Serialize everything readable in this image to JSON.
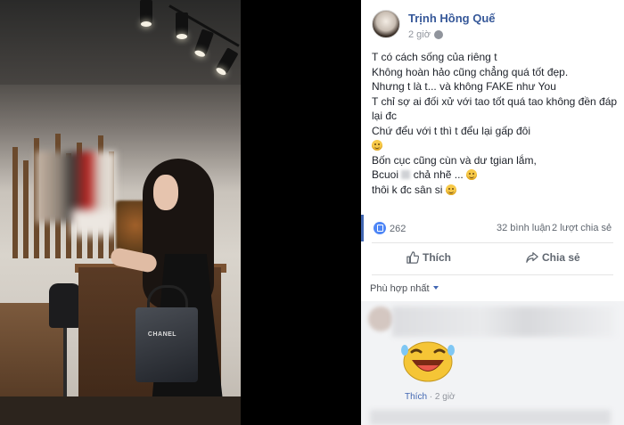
{
  "post": {
    "author": "Trịnh Hồng Quế",
    "time": "2 giờ",
    "lines": [
      "T có cách sống của riêng t",
      "Không hoàn hảo cũng chẳng quá tốt đẹp.",
      "Nhưng t là t... và không FAKE như You",
      "T chỉ sợ ai đối xử với tao tốt quá tao không đền đáp",
      "lại đc",
      "Chứ đểu với t thì t đểu lại gấp đôi",
      "Bốn cục cũng cùn và dư tgian lắm,",
      "Bcuoi",
      "chả nhẽ ...",
      "thôi k đc sân si"
    ],
    "photo_bag_text": "CHANEL"
  },
  "stats": {
    "likes": "262",
    "comments": "32 bình luận",
    "shares": "2 lượt chia sẻ"
  },
  "actions": {
    "like": "Thích",
    "share": "Chia sẻ"
  },
  "comments": {
    "sort_label": "Phù hợp nhất",
    "like_label": "Thích",
    "separator": "·",
    "time": "2 giờ"
  },
  "icons": {
    "like": "thumbs-up-icon",
    "share": "share-arrow-icon",
    "reaction": "like-reaction-icon",
    "emoji": "smiley-emoji-icon",
    "sticker": "laughing-sticker-icon"
  },
  "colors": {
    "link_blue": "#365899",
    "accent_blue": "#4267b2",
    "muted": "#90949c"
  }
}
